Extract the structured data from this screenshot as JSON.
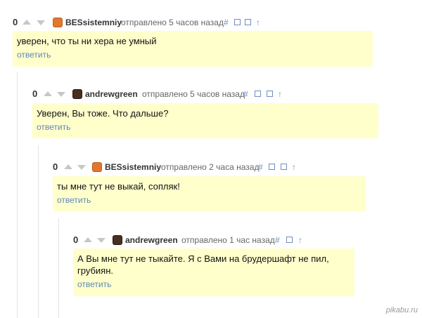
{
  "comments": [
    {
      "score": "0",
      "author": "BESsistemniy",
      "sent": "отправлено 5 часов назад",
      "text": "уверен, что ты ни хера не умный",
      "reply": "ответить"
    },
    {
      "score": "0",
      "author": "andrewgreen",
      "sent": "отправлено 5 часов назад",
      "text": "Уверен, Вы тоже. Что дальше?",
      "reply": "ответить"
    },
    {
      "score": "0",
      "author": "BESsistemniy",
      "sent": "отправлено 2 часа назад",
      "text": "ты мне тут не выкай, сопляк!",
      "reply": "ответить"
    },
    {
      "score": "0",
      "author": "andrewgreen",
      "sent": "отправлено 1 час назад",
      "text": "А Вы мне тут не тыкайте. Я с Вами на брудершафт не пил, грубиян.",
      "reply": "ответить"
    }
  ],
  "icons": {
    "hash": "#",
    "arrow": "↑"
  },
  "watermark": "pikabu.ru",
  "colors": {
    "comment_bg": "#ffffcc",
    "link": "#5f86b8",
    "icon": "#6f8dc2"
  }
}
